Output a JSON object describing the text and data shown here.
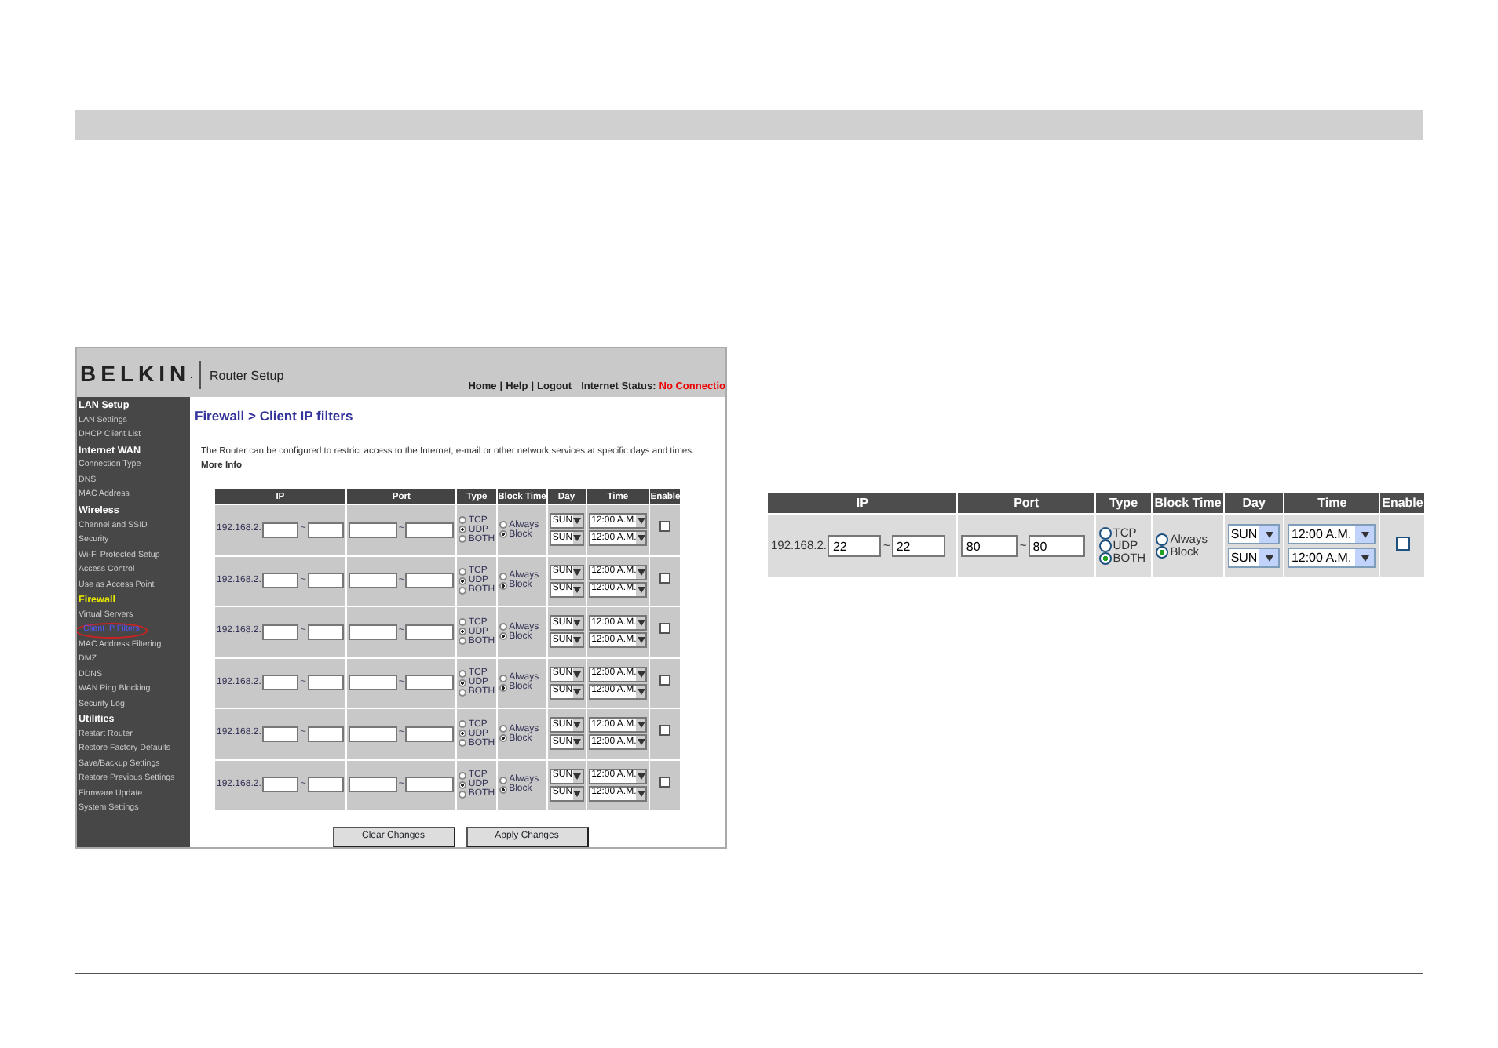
{
  "router_screenshot": {
    "brand": "BELKIN",
    "brand_mark": ".",
    "app_title": "Router Setup",
    "nav_links": [
      "Home",
      "Help",
      "Logout"
    ],
    "nav_separator": "|",
    "status_label": "Internet Status:",
    "status_value": "No Connectio",
    "sidebar": [
      {
        "heading": "LAN Setup",
        "active": false,
        "items": [
          {
            "label": "LAN Settings",
            "selected": false
          },
          {
            "label": "DHCP Client List",
            "selected": false
          }
        ]
      },
      {
        "heading": "Internet WAN",
        "active": false,
        "items": [
          {
            "label": "Connection Type",
            "selected": false
          },
          {
            "label": "DNS",
            "selected": false
          },
          {
            "label": "MAC Address",
            "selected": false
          }
        ]
      },
      {
        "heading": "Wireless",
        "active": false,
        "items": [
          {
            "label": "Channel and SSID",
            "selected": false
          },
          {
            "label": "Security",
            "selected": false
          },
          {
            "label": "Wi-Fi Protected Setup",
            "selected": false
          },
          {
            "label": "Access Control",
            "selected": false
          },
          {
            "label": "Use as Access Point",
            "selected": false
          }
        ]
      },
      {
        "heading": "Firewall",
        "active": true,
        "items": [
          {
            "label": "Virtual Servers",
            "selected": false
          },
          {
            "label": "Client IP Filters",
            "selected": true
          },
          {
            "label": "MAC Address Filtering",
            "selected": false
          },
          {
            "label": "DMZ",
            "selected": false
          },
          {
            "label": "DDNS",
            "selected": false
          },
          {
            "label": "WAN Ping Blocking",
            "selected": false
          },
          {
            "label": "Security Log",
            "selected": false
          }
        ]
      },
      {
        "heading": "Utilities",
        "active": false,
        "items": [
          {
            "label": "Restart Router",
            "selected": false
          },
          {
            "label": "Restore Factory Defaults",
            "selected": false
          },
          {
            "label": "Save/Backup Settings",
            "selected": false
          },
          {
            "label": "Restore Previous Settings",
            "selected": false
          },
          {
            "label": "Firmware Update",
            "selected": false
          },
          {
            "label": "System Settings",
            "selected": false
          }
        ]
      }
    ],
    "page_heading": "Firewall > Client IP filters",
    "description": "The Router can be configured to restrict access to the Internet, e-mail or other network services at specific days and times.",
    "more_info_link": "More Info",
    "table": {
      "columns": [
        "IP",
        "Port",
        "Type",
        "Block Time",
        "Day",
        "Time",
        "Enable"
      ],
      "rows": [
        {
          "ip_prefix": "192.168.2.",
          "separator": "~",
          "type": [
            {
              "label": "TCP",
              "selected": false
            },
            {
              "label": "UDP",
              "selected": true
            },
            {
              "label": "BOTH",
              "selected": false
            }
          ],
          "block_time": [
            {
              "label": "Always",
              "selected": false
            },
            {
              "label": "Block",
              "selected": true
            }
          ],
          "days": [
            "SUN",
            "SUN"
          ],
          "times": [
            "12:00 A.M.",
            "12:00 A.M."
          ],
          "enabled": false
        },
        {
          "ip_prefix": "192.168.2.",
          "separator": "~",
          "type": [
            {
              "label": "TCP",
              "selected": false
            },
            {
              "label": "UDP",
              "selected": true
            },
            {
              "label": "BOTH",
              "selected": false
            }
          ],
          "block_time": [
            {
              "label": "Always",
              "selected": false
            },
            {
              "label": "Block",
              "selected": true
            }
          ],
          "days": [
            "SUN",
            "SUN"
          ],
          "times": [
            "12:00 A.M.",
            "12:00 A.M."
          ],
          "enabled": false
        },
        {
          "ip_prefix": "192.168.2.",
          "separator": "~",
          "type": [
            {
              "label": "TCP",
              "selected": false
            },
            {
              "label": "UDP",
              "selected": true
            },
            {
              "label": "BOTH",
              "selected": false
            }
          ],
          "block_time": [
            {
              "label": "Always",
              "selected": false
            },
            {
              "label": "Block",
              "selected": true
            }
          ],
          "days": [
            "SUN",
            "SUN"
          ],
          "times": [
            "12:00 A.M.",
            "12:00 A.M."
          ],
          "enabled": false
        },
        {
          "ip_prefix": "192.168.2.",
          "separator": "~",
          "type": [
            {
              "label": "TCP",
              "selected": false
            },
            {
              "label": "UDP",
              "selected": true
            },
            {
              "label": "BOTH",
              "selected": false
            }
          ],
          "block_time": [
            {
              "label": "Always",
              "selected": false
            },
            {
              "label": "Block",
              "selected": true
            }
          ],
          "days": [
            "SUN",
            "SUN"
          ],
          "times": [
            "12:00 A.M.",
            "12:00 A.M."
          ],
          "enabled": false
        },
        {
          "ip_prefix": "192.168.2.",
          "separator": "~",
          "type": [
            {
              "label": "TCP",
              "selected": false
            },
            {
              "label": "UDP",
              "selected": true
            },
            {
              "label": "BOTH",
              "selected": false
            }
          ],
          "block_time": [
            {
              "label": "Always",
              "selected": false
            },
            {
              "label": "Block",
              "selected": true
            }
          ],
          "days": [
            "SUN",
            "SUN"
          ],
          "times": [
            "12:00 A.M.",
            "12:00 A.M."
          ],
          "enabled": false
        },
        {
          "ip_prefix": "192.168.2.",
          "separator": "~",
          "type": [
            {
              "label": "TCP",
              "selected": false
            },
            {
              "label": "UDP",
              "selected": true
            },
            {
              "label": "BOTH",
              "selected": false
            }
          ],
          "block_time": [
            {
              "label": "Always",
              "selected": false
            },
            {
              "label": "Block",
              "selected": true
            }
          ],
          "days": [
            "SUN",
            "SUN"
          ],
          "times": [
            "12:00 A.M.",
            "12:00 A.M."
          ],
          "enabled": false
        }
      ]
    },
    "buttons": [
      "Clear Changes",
      "Apply Changes"
    ]
  },
  "detail_table": {
    "columns": [
      "IP",
      "Port",
      "Type",
      "Block Time",
      "Day",
      "Time",
      "Enable"
    ],
    "rows": [
      {
        "ip_prefix": "192.168.2.",
        "ip_from": "22",
        "ip_to": "22",
        "port_from": "80",
        "port_to": "80",
        "separator": "~",
        "type": [
          {
            "label": "TCP",
            "selected": false
          },
          {
            "label": "UDP",
            "selected": false
          },
          {
            "label": "BOTH",
            "selected": true
          }
        ],
        "block_time": [
          {
            "label": "Always",
            "selected": false
          },
          {
            "label": "Block",
            "selected": true
          }
        ],
        "days": [
          "SUN",
          "SUN"
        ],
        "times": [
          "12:00 A.M.",
          "12:00 A.M."
        ],
        "enabled": false
      }
    ]
  }
}
